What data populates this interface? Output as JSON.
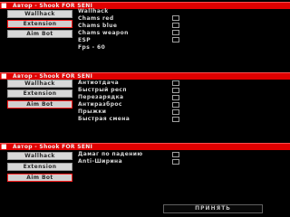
{
  "panels": [
    {
      "title": "Автор - Shook FOR SENI",
      "tabs": [
        "Wallhack",
        "Extension",
        "Aim Bot"
      ],
      "options": [
        "Wallhack",
        "Chams red",
        "Chams blue",
        "Chams weapon",
        "ESP",
        "Fps - 60"
      ]
    },
    {
      "title": "Автор - Shook FOR SENI",
      "tabs": [
        "Wallhack",
        "Extension",
        "Aim Bot"
      ],
      "options": [
        "Антиотдача",
        "Быстрый респ",
        "Перезарядка",
        "Антиразброс",
        "Прыжки",
        "Быстрая смена"
      ]
    },
    {
      "title": "Автор - Shook FOR SENI",
      "tabs": [
        "Wallhack",
        "Extension",
        "Aim Bot"
      ],
      "options": [
        "Дамаг по падению",
        "Anti-Ширина"
      ]
    }
  ],
  "footer": {
    "label": "ПРИНЯТЬ"
  }
}
